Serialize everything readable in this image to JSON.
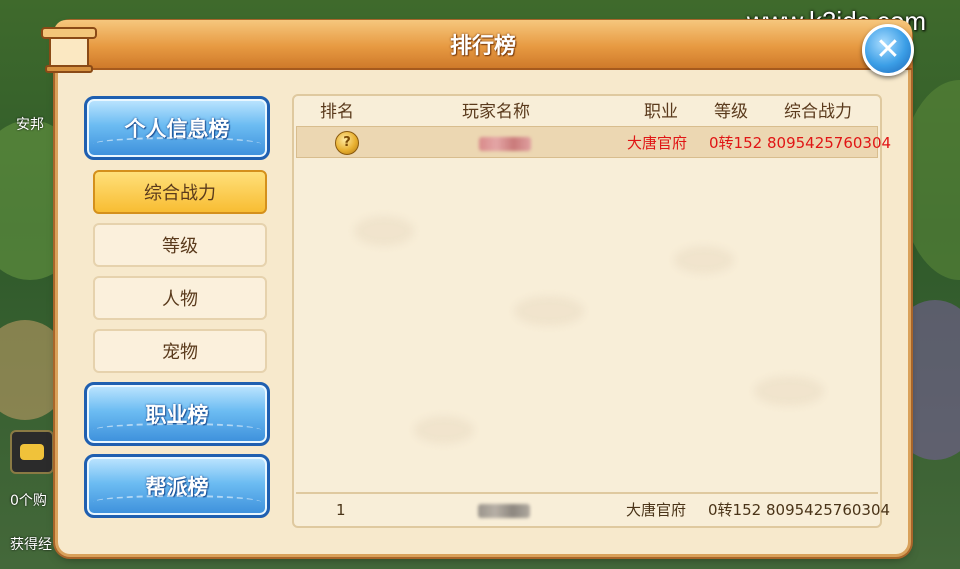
{
  "watermark": "www.k3idc.com",
  "window": {
    "title": "排行榜"
  },
  "menu": {
    "big_items": [
      "个人信息榜",
      "职业榜",
      "帮派榜"
    ],
    "sub_items": [
      "综合战力",
      "等级",
      "人物",
      "宠物"
    ],
    "active_sub": "综合战力"
  },
  "table": {
    "headers": [
      "排名",
      "玩家名称",
      "职业",
      "等级",
      "综合战力"
    ],
    "rows": [
      {
        "rank": "",
        "name": "",
        "profession": "大唐官府",
        "level": "0转152",
        "power": "8095425760304"
      }
    ],
    "my_rank": {
      "rank": "1",
      "name": "",
      "profession": "大唐官府",
      "level": "0转152",
      "power": "8095425760304"
    }
  },
  "background": {
    "left_texts": [
      "安邦",
      "0个购",
      "获得经"
    ]
  },
  "colors": {
    "title_bar": "#e79a42",
    "menu_blue": "#3c8fdb",
    "menu_active": "#f8bd33",
    "highlight_text": "#e01515"
  },
  "icons": {
    "close": "close-icon",
    "rank_medal": "gold-medal-icon",
    "chat": "chat-icon"
  }
}
